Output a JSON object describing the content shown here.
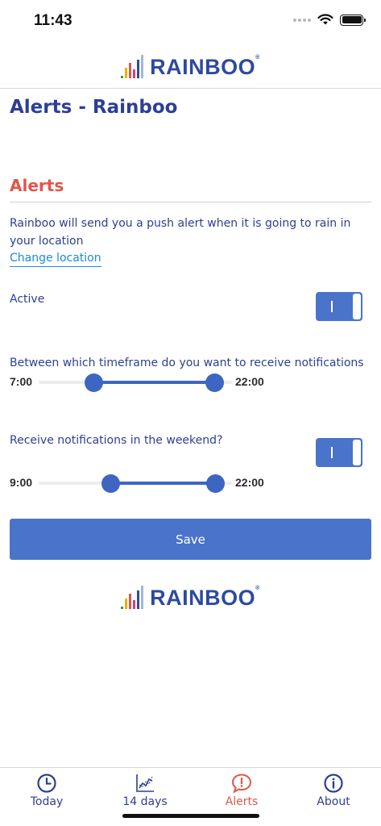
{
  "status_bar": {
    "time": "11:43"
  },
  "brand": {
    "name": "RAINBOO",
    "mark": "®"
  },
  "page": {
    "title": "Alerts - Rainboo"
  },
  "alerts_section": {
    "title": "Alerts",
    "intro": "Rainboo will send you a push alert when it is going to rain in your location",
    "change_location": "Change location"
  },
  "settings": {
    "active_label": "Active",
    "active_on": true,
    "timeframe_label": "Between which timeframe do you want to receive notifications",
    "timeframe_start": "7:00",
    "timeframe_end": "22:00",
    "weekend_label": "Receive notifications in the weekend?",
    "weekend_on": true,
    "weekend_start": "9:00",
    "weekend_end": "22:00"
  },
  "actions": {
    "save_label": "Save"
  },
  "tab_bar": {
    "items": [
      {
        "label": "Today",
        "icon": "clock-icon"
      },
      {
        "label": "14 days",
        "icon": "line-chart-icon"
      },
      {
        "label": "Alerts",
        "icon": "alert-bubble-icon",
        "active": true
      },
      {
        "label": "About",
        "icon": "info-icon"
      }
    ]
  },
  "colors": {
    "brand_blue": "#2d3f93",
    "accent_red": "#e0564a",
    "button_blue": "#4a74c9",
    "link_blue": "#1e8ad6"
  }
}
